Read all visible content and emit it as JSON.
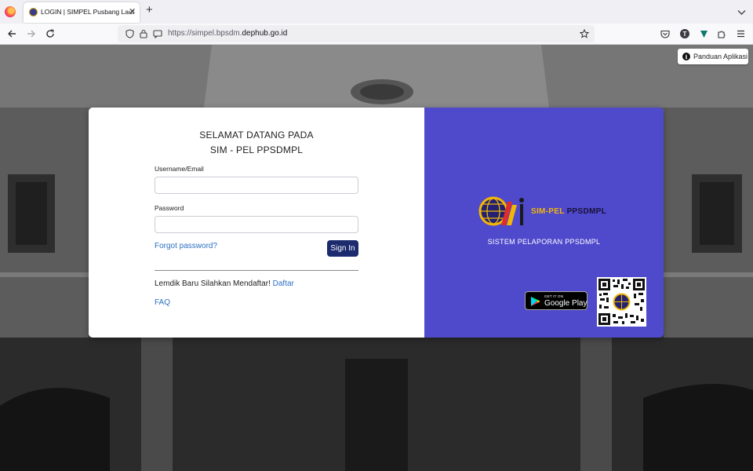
{
  "browser": {
    "tab_title": "LOGIN | SIMPEL Pusbang Laut",
    "tab_close": "✕",
    "new_tab": "+",
    "url_prefix": "https://simpel.bpsdm.",
    "url_domain": "dephub.go.id",
    "toolbar_profile_letter": "T"
  },
  "page": {
    "guide_button": "Panduan Aplikasi",
    "guide_icon_glyph": "i",
    "welcome_line1": "SELAMAT DATANG PADA",
    "welcome_line2": "SIM - PEL PPSDMPL",
    "username_label": "Username/Email",
    "password_label": "Password",
    "forgot_password": "Forgot password?",
    "sign_in": "Sign In",
    "register_text": "Lemdik Baru Silahkan Mendaftar!",
    "register_link": "Daftar",
    "faq": "FAQ",
    "logo_sim": "SIM-PEL",
    "logo_org": "PPSDMPL",
    "tagline": "SISTEM PELAPORAN PPSDMPL",
    "store_small": "GET IT ON",
    "store_big": "Google Play"
  },
  "colors": {
    "panel_purple": "#4f49cc",
    "sign_in_button": "#1c2a6e",
    "link_blue": "#2c6fc2",
    "logo_yellow": "#f2b705"
  }
}
